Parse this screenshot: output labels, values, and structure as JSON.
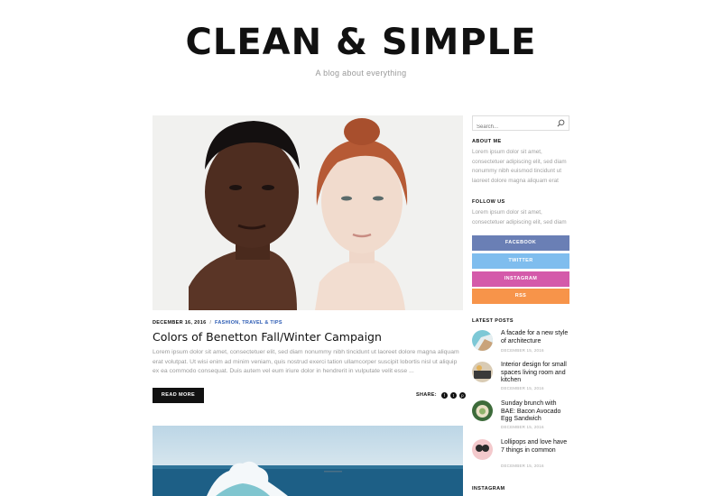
{
  "header": {
    "title": "CLEAN & SIMPLE",
    "tagline": "A blog about everything"
  },
  "post": {
    "date": "DECEMBER 16, 2016",
    "separator": "/",
    "categories": "FASHION, TRAVEL & TIPS",
    "title": "Colors of Benetton Fall/Winter Campaign",
    "excerpt": "Lorem ipsum dolor sit amet, consectetuer elit, sed diam nonummy nibh tincidunt ut laoreet dolore magna aliquam erat volutpat. Ut wisi enim ad minim veniam, quis nostrud exerci tation ullamcorper suscipit lobortis nisl ut aliquip ex ea commodo consequat. Duis autem vel eum iriure dolor in hendrerit in vulputate velit esse ...",
    "read_more": "READ MORE",
    "share_label": "SHARE:",
    "share_icons": [
      "facebook-icon",
      "twitter-icon",
      "pinterest-icon"
    ]
  },
  "sidebar": {
    "search_placeholder": "Search...",
    "about": {
      "title": "ABOUT ME",
      "text": "Lorem ipsum dolor sit amet, consectetuer adipiscing elit, sed diam nonummy nibh euismod tincidunt ut laoreet dolore magna aliquam erat"
    },
    "follow": {
      "title": "FOLLOW US",
      "text": "Lorem ipsum dolor sit amet, consectetuer adipiscing elit, sed diam",
      "buttons": [
        {
          "label": "FACEBOOK",
          "color": "#6a7fb5"
        },
        {
          "label": "TWITTER",
          "color": "#7fbdee"
        },
        {
          "label": "INSTAGRAM",
          "color": "#d45aaa"
        },
        {
          "label": "RSS",
          "color": "#f7944a"
        }
      ]
    },
    "latest_posts": {
      "title": "LATEST POSTS",
      "items": [
        {
          "title": "A facade for a new style of architecture",
          "date": "DECEMBER 15, 2016"
        },
        {
          "title": "Interior design for small spaces living room and kitchen",
          "date": "DECEMBER 15, 2016"
        },
        {
          "title": "Sunday brunch with BAE: Bacon Avocado Egg Sandwich",
          "date": "DECEMBER 15, 2016"
        },
        {
          "title": "Lollipops and love have 7 things in common",
          "date": "DECEMBER 15, 2016"
        }
      ]
    },
    "instagram_title": "INSTAGRAM"
  }
}
